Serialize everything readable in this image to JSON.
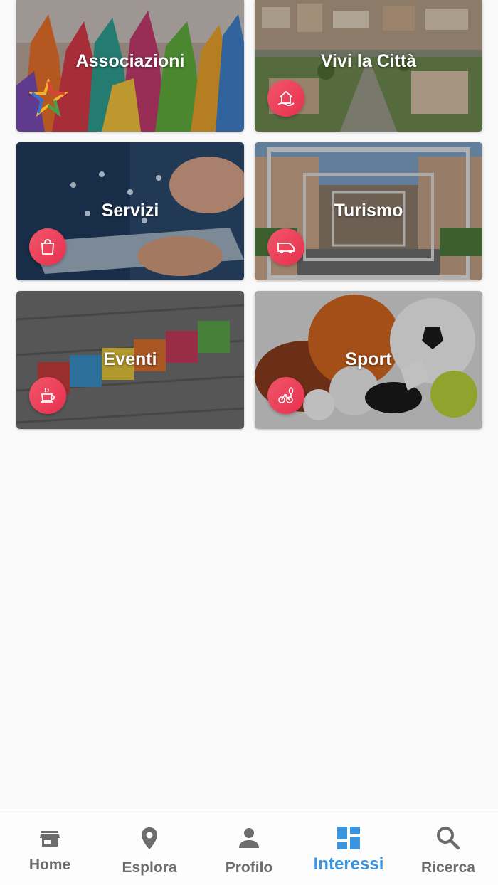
{
  "tiles": [
    {
      "label": "Associazioni",
      "icon": "colorful-star-logo-icon"
    },
    {
      "label": "Vivi la Città",
      "icon": "house-hand-icon"
    },
    {
      "label": "Servizi",
      "icon": "shopping-bag-icon"
    },
    {
      "label": "Turismo",
      "icon": "van-icon"
    },
    {
      "label": "Eventi",
      "icon": "coffee-cup-icon"
    },
    {
      "label": "Sport",
      "icon": "bicycle-tree-icon"
    }
  ],
  "tabs": [
    {
      "label": "Home",
      "icon": "store-icon"
    },
    {
      "label": "Esplora",
      "icon": "location-pin-icon"
    },
    {
      "label": "Profilo",
      "icon": "person-icon"
    },
    {
      "label": "Interessi",
      "icon": "dashboard-grid-icon"
    },
    {
      "label": "Ricerca",
      "icon": "search-icon"
    }
  ],
  "colors": {
    "accent": "#3b95de",
    "badge": "#e8304e",
    "inactive": "#6c6c6c",
    "background": "#f9f9f9"
  }
}
